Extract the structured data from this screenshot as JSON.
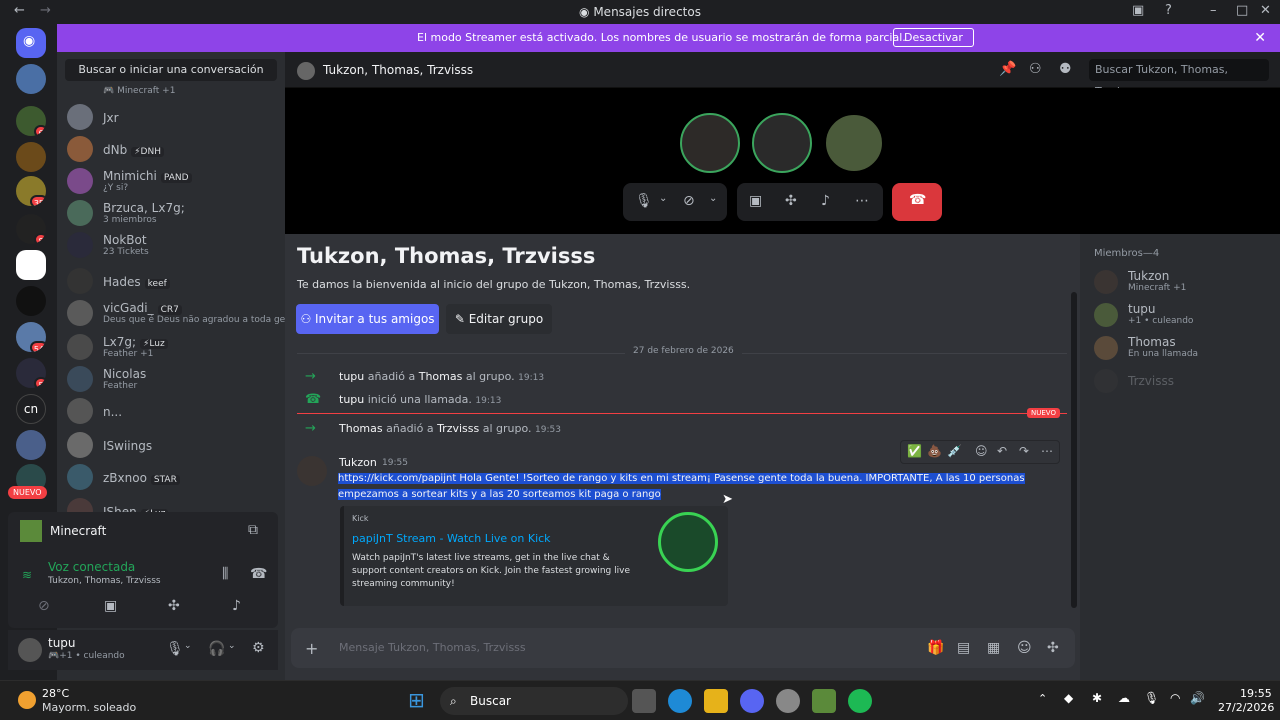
{
  "window": {
    "title": "Mensajes directos"
  },
  "banner": {
    "text": "El modo Streamer está activado. Los nombres de usuario se mostrarán de forma parcial.",
    "button": "Desactivar"
  },
  "rail": {
    "badges": [
      "6",
      "35",
      "8",
      "54",
      "5"
    ],
    "cn_label": "cn",
    "new_label": "NUEVO"
  },
  "sidebar": {
    "search_placeholder": "Buscar o iniciar una conversación",
    "top_sub": "Minecraft +1",
    "dms": [
      {
        "name": "Jxr",
        "sub": "",
        "tag": ""
      },
      {
        "name": "dNb",
        "sub": "",
        "tag": "⚡DNH"
      },
      {
        "name": "Mnimichi",
        "sub": "¿Y si?",
        "tag": "PAND"
      },
      {
        "name": "Brzuca, Lx7g;",
        "sub": "3 miembros",
        "tag": ""
      },
      {
        "name": "NokBot",
        "sub": "23 Tickets",
        "tag": ""
      },
      {
        "name": "Hades",
        "sub": "",
        "tag": "keef"
      },
      {
        "name": "vicGadi_",
        "sub": "Deus que é Deus não agradou a toda ge",
        "tag": "CR7"
      },
      {
        "name": "Lx7g;",
        "sub": "Feather +1",
        "tag": "⚡Luz"
      },
      {
        "name": "Nicolas",
        "sub": "Feather",
        "tag": ""
      },
      {
        "name": "n...",
        "sub": "",
        "tag": ""
      },
      {
        "name": "ISwiings",
        "sub": "",
        "tag": ""
      },
      {
        "name": "zBxnoo",
        "sub": "",
        "tag": "STAR"
      },
      {
        "name": "JShen",
        "sub": "",
        "tag": "⚡Luz"
      }
    ]
  },
  "voice": {
    "server": "Minecraft",
    "status": "Voz conectada",
    "channel": "Tukzon, Thomas, Trzvisss"
  },
  "user": {
    "name": "tupu",
    "status": "culeando"
  },
  "header": {
    "title": "Tukzon, Thomas, Trzvisss",
    "search_placeholder": "Buscar Tukzon, Thomas, Trzvisss"
  },
  "chat": {
    "group_title": "Tukzon, Thomas, Trzvisss",
    "welcome": "Te damos la bienvenida al inicio del grupo de Tukzon, Thomas, Trzvisss.",
    "invite_btn": "Invitar a tus amigos",
    "edit_btn": "Editar grupo",
    "date": "27 de febrero de 2026",
    "new_label": "NUEVO",
    "sys1": {
      "user": "tupu",
      "action": "añadió a",
      "target": "Thomas",
      "rest": "al grupo.",
      "time": "19:13"
    },
    "sys2": {
      "user": "tupu",
      "action": "inició una llamada.",
      "time": "19:13"
    },
    "sys3": {
      "user": "Thomas",
      "action": "añadió a",
      "target": "Trzvisss",
      "rest": "al grupo.",
      "time": "19:53"
    },
    "msg": {
      "author": "Tukzon",
      "time": "19:55",
      "line1": "https://kick.com/papijnt Hola Gente! !Sorteo de rango y kits en mi stream¡ Pasense gente toda la buena. IMPORTANTE, A las 10 personas",
      "line2": "empezamos a sortear kits y a las 20 sorteamos kit paga o rango"
    },
    "embed": {
      "provider": "Kick",
      "title": "papiJnT Stream - Watch Live on Kick",
      "desc": "Watch papiJnT's latest live streams, get in the live chat & support content creators on Kick. Join the fastest growing live streaming community!"
    },
    "input_placeholder": "Mensaje Tukzon, Thomas, Trzvisss"
  },
  "members": {
    "heading": "Miembros—4",
    "list": [
      {
        "name": "Tukzon",
        "status": "Minecraft +1"
      },
      {
        "name": "tupu",
        "status": "+1 • culeando"
      },
      {
        "name": "Thomas",
        "status": "En una llamada"
      },
      {
        "name": "Trzvisss",
        "status": ""
      }
    ]
  },
  "taskbar": {
    "temp": "28°C",
    "weather": "Mayorm. soleado",
    "search": "Buscar",
    "time": "19:55",
    "date": "27/2/2026"
  },
  "colors": {
    "accent": "#5865f2",
    "banner": "#8e44e8",
    "online": "#23a559",
    "danger": "#da373c"
  }
}
